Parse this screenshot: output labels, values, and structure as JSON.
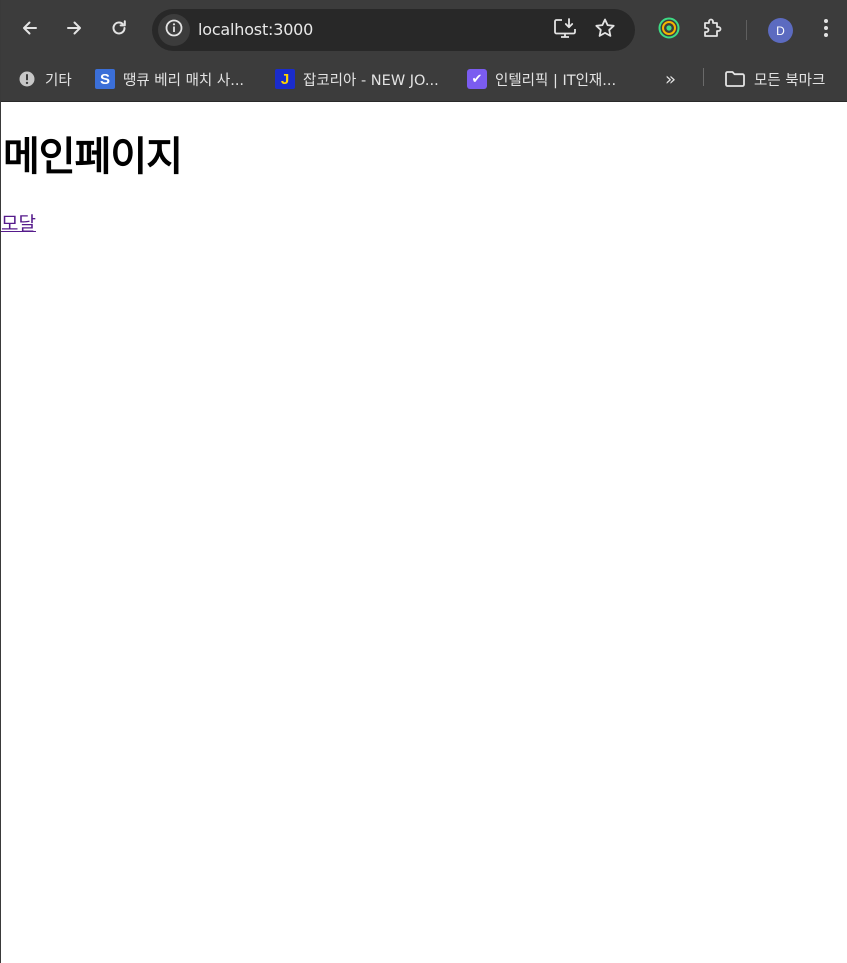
{
  "browser": {
    "url": "localhost:3000",
    "avatar_letter": "D",
    "icons": {
      "back": "arrow-left-icon",
      "forward": "arrow-right-icon",
      "reload": "reload-icon",
      "site_info": "info-icon",
      "install": "install-app-icon",
      "bookmark_star": "star-icon",
      "extension_a": "target-icon",
      "extensions": "puzzle-icon",
      "menu": "kebab-menu-icon"
    }
  },
  "bookmarks": {
    "items": [
      {
        "label": "기타",
        "icon": "alert-circle-icon"
      },
      {
        "label": "땡큐 베리 매치 사...",
        "icon": "s-favicon",
        "badge": "S"
      },
      {
        "label": "잡코리아 - NEW JO...",
        "icon": "j-favicon",
        "badge": "J"
      },
      {
        "label": "인텔리픽 | IT인재...",
        "icon": "check-favicon",
        "badge": "✔"
      }
    ],
    "overflow": "»",
    "all_bookmarks_label": "모든 북마크"
  },
  "page": {
    "heading": "메인페이지",
    "link_label": "모달"
  },
  "colors": {
    "chrome_bg": "#3c3c3c",
    "omnibox_bg": "#282828",
    "visited_link": "#551a8b",
    "avatar_bg": "#5c6bc0"
  }
}
